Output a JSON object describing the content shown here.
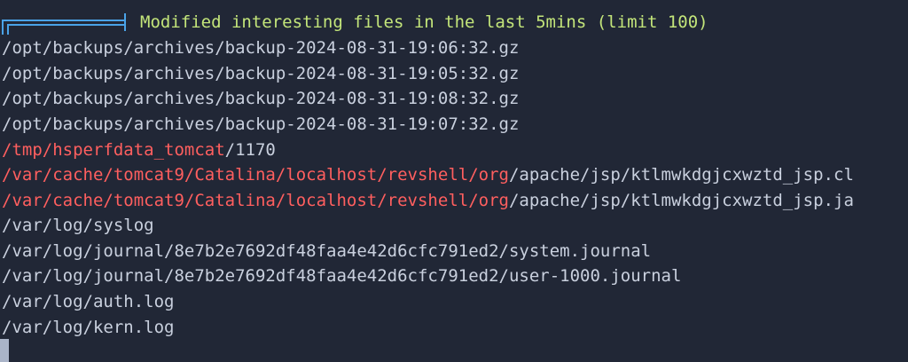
{
  "header": {
    "title": "Modified interesting files in the last 5mins (limit 100)"
  },
  "lines": [
    {
      "highlight": "",
      "rest": "/opt/backups/archives/backup-2024-08-31-19:06:32.gz"
    },
    {
      "highlight": "",
      "rest": "/opt/backups/archives/backup-2024-08-31-19:05:32.gz"
    },
    {
      "highlight": "",
      "rest": "/opt/backups/archives/backup-2024-08-31-19:08:32.gz"
    },
    {
      "highlight": "",
      "rest": "/opt/backups/archives/backup-2024-08-31-19:07:32.gz"
    },
    {
      "highlight": "/tmp/hsperfdata_tomcat",
      "rest": "/1170"
    },
    {
      "highlight": "/var/cache/tomcat9/Catalina/localhost/revshell/org",
      "rest": "/apache/jsp/ktlmwkdgjcxwztd_jsp.cl"
    },
    {
      "highlight": "/var/cache/tomcat9/Catalina/localhost/revshell/org",
      "rest": "/apache/jsp/ktlmwkdgjcxwztd_jsp.ja"
    },
    {
      "highlight": "",
      "rest": "/var/log/syslog"
    },
    {
      "highlight": "",
      "rest": "/var/log/journal/8e7b2e7692df48faa4e42d6cfc791ed2/system.journal"
    },
    {
      "highlight": "",
      "rest": "/var/log/journal/8e7b2e7692df48faa4e42d6cfc791ed2/user-1000.journal"
    },
    {
      "highlight": "",
      "rest": "/var/log/auth.log"
    },
    {
      "highlight": "",
      "rest": "/var/log/kern.log"
    }
  ],
  "colors": {
    "background": "#212736",
    "header_text": "#c3e57a",
    "decoration": "#4aa3e8",
    "highlight": "#ff5f5f",
    "text": "#c9d0de"
  }
}
